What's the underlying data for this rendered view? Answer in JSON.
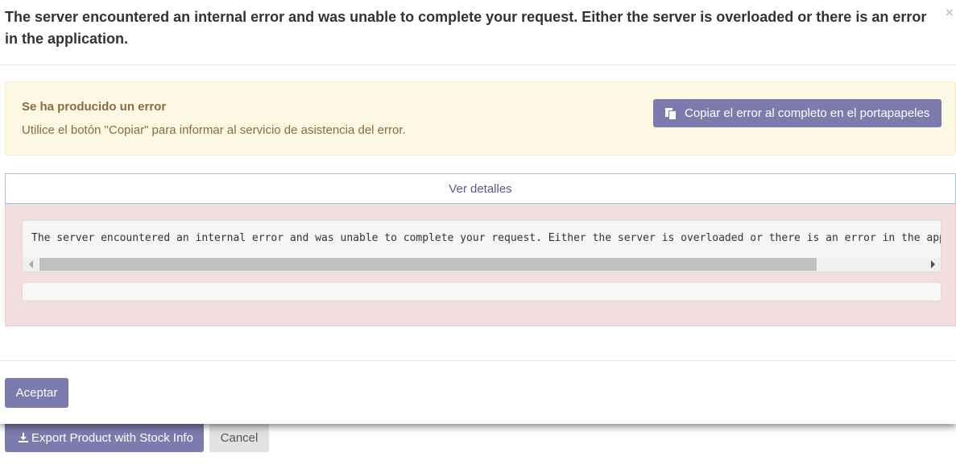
{
  "background": {
    "export_button_label": "Export Product with Stock Info",
    "export_icon": "download-icon",
    "cancel_button_label": "Cancel"
  },
  "modal": {
    "title": "The server encountered an internal error and was unable to complete your request. Either the server is overloaded or there is an error in the application.",
    "close_label": "×",
    "warning": {
      "heading": "Se ha producido un error",
      "text": "Utilice el botón \"Copiar\" para informar al servicio de asistencia del error.",
      "copy_button_label": "Copiar el error al completo en el portapapeles",
      "copy_icon": "clipboard-icon"
    },
    "details_toggle_label": "Ver detalles",
    "error_detail_text": "The server encountered an internal error and was unable to complete your request.  Either the server is overloaded or there is an error in the application.",
    "accept_button_label": "Aceptar"
  },
  "colors": {
    "primary": "#7c7bad",
    "warning_bg": "#fcf8e3",
    "warning_text": "#8a6d3b",
    "danger_bg": "#f2dede",
    "toggle_border": "#a4c1e8"
  }
}
